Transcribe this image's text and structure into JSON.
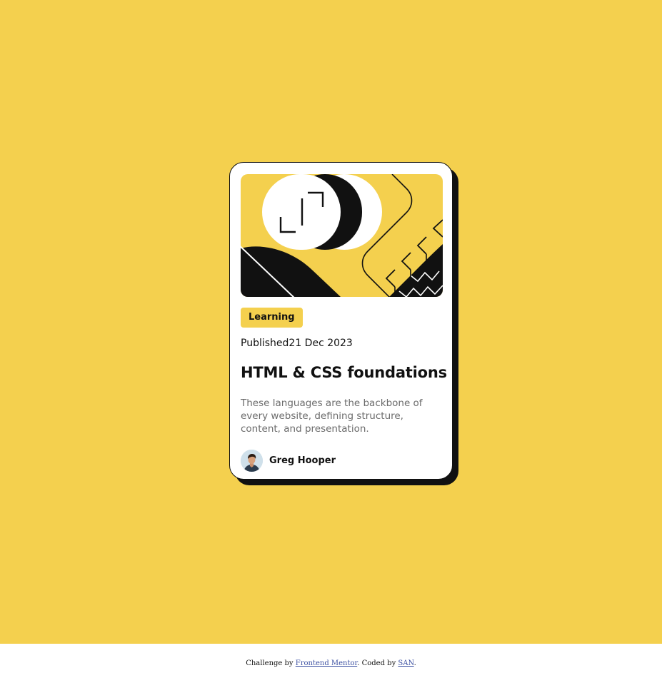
{
  "colors": {
    "background": "#f4d04e",
    "card": "#ffffff",
    "ink": "#111111",
    "muted": "#6b6b6b",
    "link": "#3e52a3"
  },
  "card": {
    "hero_image": "illustration-article",
    "category": "Learning",
    "published_label": "Published",
    "published_date": "21 Dec 2023",
    "title": "HTML & CSS foundations",
    "description": "These languages are the backbone of every website, defining structure, content, and presentation.",
    "author": {
      "name": "Greg Hooper",
      "avatar": "avatar-photo"
    }
  },
  "footer": {
    "prefix": "Challenge by ",
    "mentor_link": "Frontend Mentor",
    "middle": ". Coded by ",
    "coder_link": "SAN",
    "suffix": "."
  }
}
